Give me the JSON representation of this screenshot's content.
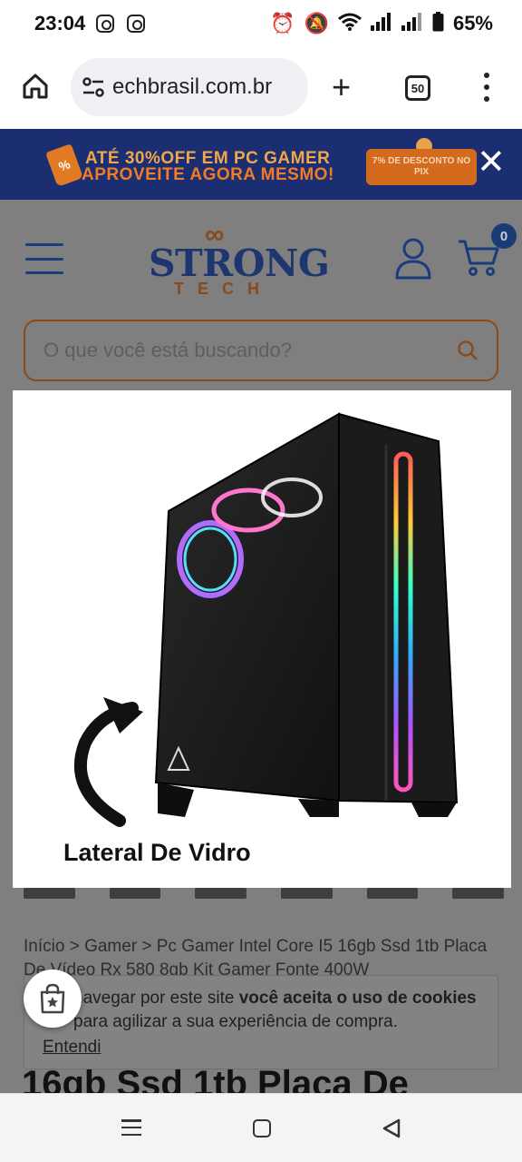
{
  "status_bar": {
    "time": "23:04",
    "battery": "65%",
    "icons": [
      "instagram-icon",
      "instagram-icon",
      "alarm-icon",
      "mute-icon",
      "wifi-icon",
      "signal-icon",
      "signal-icon",
      "battery-icon"
    ]
  },
  "browser": {
    "url": "echbrasil.com.br",
    "tab_count": "50"
  },
  "promo": {
    "tag_symbol": "%",
    "line1": "ATÉ 30%OFF EM PC GAMER",
    "line2": "APROVEITE AGORA MESMO!",
    "badge": "7% DE DESCONTO NO PIX"
  },
  "header": {
    "logo_mark": "∞",
    "logo_main": "STRONG",
    "logo_sub": "TECH",
    "cart_count": "0"
  },
  "search": {
    "placeholder": "O que você está buscando?"
  },
  "product_image": {
    "caption": "Lateral De Vidro"
  },
  "breadcrumb": "Início > Gamer > Pc Gamer Intel Core I5 16gb Ssd 1tb Placa De Vídeo Rx 580 8gb Kit Gamer Fonte 400W",
  "cookie": {
    "text_pre": "navegar por este site ",
    "text_bold1": "você aceita o uso de cookies",
    "text_post": " para agilizar a sua experiência de compra.",
    "accept": "Entendi"
  },
  "product_title": "16gb Ssd 1tb Placa De",
  "colors": {
    "navy": "#1c2e72",
    "orange": "#f07c26",
    "brand_blue": "#1d3670",
    "brand_bronze": "#8a4a1a"
  }
}
